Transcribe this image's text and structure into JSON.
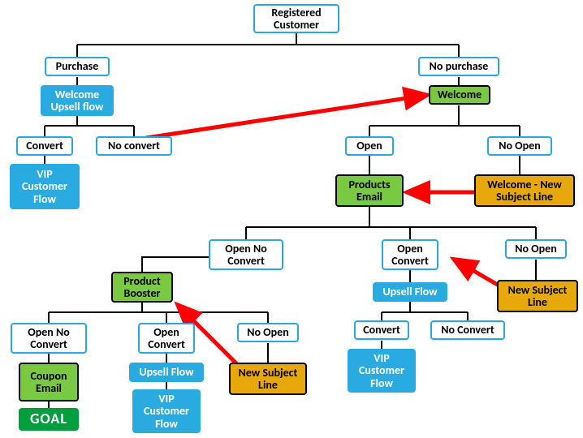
{
  "chart_data": {
    "type": "flowchart",
    "title": "",
    "nodes": {
      "root": {
        "label": "Registered Customer",
        "style": "white"
      },
      "purchase": {
        "label": "Purchase",
        "style": "white"
      },
      "no_purchase": {
        "label": "No purchase",
        "style": "white"
      },
      "welcome_upsell": {
        "label": "Welcome Upsell flow",
        "style": "blue"
      },
      "welcome": {
        "label": "Welcome",
        "style": "green"
      },
      "convert1": {
        "label": "Convert",
        "style": "white"
      },
      "no_convert1": {
        "label": "No convert",
        "style": "white"
      },
      "vip1": {
        "label": "VIP Customer Flow",
        "style": "blue"
      },
      "open1": {
        "label": "Open",
        "style": "white"
      },
      "no_open1": {
        "label": "No Open",
        "style": "white"
      },
      "products_email": {
        "label": "Products Email",
        "style": "green"
      },
      "welcome_new_subj": {
        "label": "Welcome - New Subject Line",
        "style": "orange"
      },
      "open_no_conv2": {
        "label": "Open No Convert",
        "style": "white"
      },
      "open_conv2": {
        "label": "Open Convert",
        "style": "white"
      },
      "no_open2": {
        "label": "No Open",
        "style": "white"
      },
      "product_booster": {
        "label": "Product Booster",
        "style": "green"
      },
      "upsell2": {
        "label": "Upsell Flow",
        "style": "blue"
      },
      "new_subj2": {
        "label": "New Subject Line",
        "style": "orange"
      },
      "convert3": {
        "label": "Convert",
        "style": "white"
      },
      "no_convert3": {
        "label": "No Convert",
        "style": "white"
      },
      "vip3": {
        "label": "VIP Customer Flow",
        "style": "blue"
      },
      "open_no_conv4": {
        "label": "Open No Convert",
        "style": "white"
      },
      "open_conv4": {
        "label": "Open Convert",
        "style": "white"
      },
      "no_open4": {
        "label": "No Open",
        "style": "white"
      },
      "coupon_email": {
        "label": "Coupon Email",
        "style": "green"
      },
      "upsell4": {
        "label": "Upsell Flow",
        "style": "blue"
      },
      "new_subj4": {
        "label": "New Subject Line",
        "style": "orange"
      },
      "vip4": {
        "label": "VIP Customer Flow",
        "style": "blue"
      },
      "goal": {
        "label": "GOAL",
        "style": "goal"
      }
    },
    "edges_black": [
      [
        "root",
        "purchase"
      ],
      [
        "root",
        "no_purchase"
      ],
      [
        "purchase",
        "welcome_upsell"
      ],
      [
        "no_purchase",
        "welcome"
      ],
      [
        "welcome_upsell",
        "convert1"
      ],
      [
        "welcome_upsell",
        "no_convert1"
      ],
      [
        "convert1",
        "vip1"
      ],
      [
        "welcome",
        "open1"
      ],
      [
        "welcome",
        "no_open1"
      ],
      [
        "open1",
        "products_email"
      ],
      [
        "no_open1",
        "welcome_new_subj"
      ],
      [
        "products_email",
        "open_no_conv2"
      ],
      [
        "products_email",
        "open_conv2"
      ],
      [
        "products_email",
        "no_open2"
      ],
      [
        "open_no_conv2",
        "product_booster"
      ],
      [
        "open_conv2",
        "upsell2"
      ],
      [
        "no_open2",
        "new_subj2"
      ],
      [
        "upsell2",
        "convert3"
      ],
      [
        "upsell2",
        "no_convert3"
      ],
      [
        "convert3",
        "vip3"
      ],
      [
        "product_booster",
        "open_no_conv4"
      ],
      [
        "product_booster",
        "open_conv4"
      ],
      [
        "product_booster",
        "no_open4"
      ],
      [
        "open_no_conv4",
        "coupon_email"
      ],
      [
        "open_conv4",
        "upsell4"
      ],
      [
        "no_open4",
        "new_subj4"
      ],
      [
        "upsell4",
        "vip4"
      ],
      [
        "coupon_email",
        "goal"
      ]
    ],
    "edges_red": [
      [
        "no_convert1",
        "welcome"
      ],
      [
        "welcome_new_subj",
        "products_email"
      ],
      [
        "new_subj2",
        "open_conv2"
      ],
      [
        "new_subj4",
        "product_booster"
      ]
    ]
  }
}
